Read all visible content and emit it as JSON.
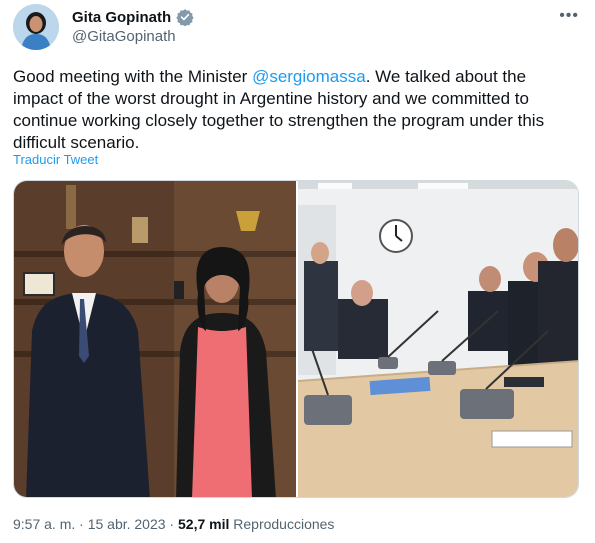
{
  "author": {
    "name": "Gita Gopinath",
    "handle": "@GitaGopinath",
    "verified_color": "#829aab"
  },
  "tweet": {
    "text_before": "Good meeting with the Minister ",
    "mention": "@sergiomassa",
    "text_after": ". We talked about the impact of the worst drought in Argentine history and we committed to continue working closely together to strengthen the program under this difficult scenario.",
    "translate_label": "Traducir Tweet"
  },
  "menu": {
    "more_label": "•••"
  },
  "footer": {
    "time_date": "9:57 a. m. · 15 abr. 2023 · ",
    "views_count": "52,7 mil",
    "views_label": " Reproducciones"
  },
  "colors": {
    "accent": "#1d9bf0",
    "text": "#0f1419",
    "secondary": "#536471"
  }
}
